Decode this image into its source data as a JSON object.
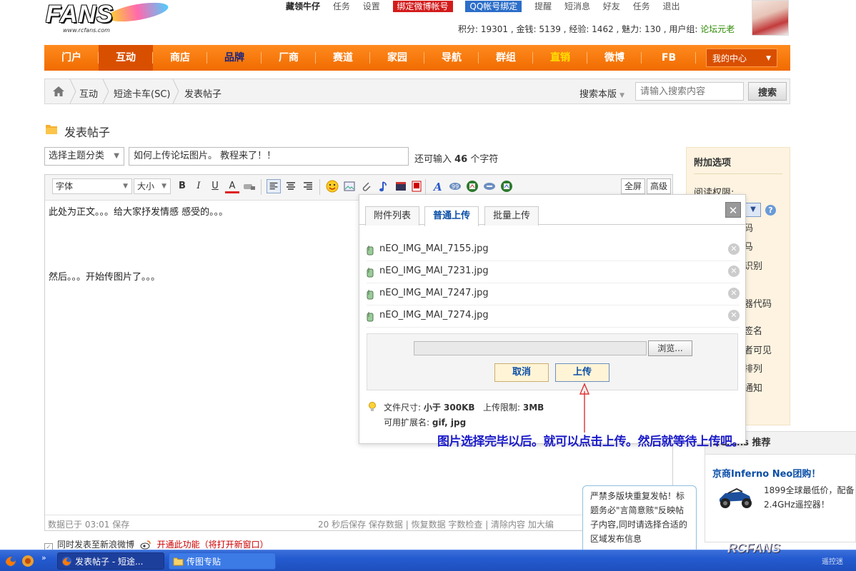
{
  "header": {
    "logo_text": "FANS",
    "logo_url": "www.rcfans.com",
    "top_links": [
      "藏领牛仔",
      "任务",
      "设置",
      "绑定微博帐号",
      "QQ帐号绑定",
      "提醒",
      "短消息",
      "好友",
      "任务",
      "退出"
    ],
    "stats_prefix": "积分: 19301 , 金钱: 5139 , 经验: 1462 , 魅力: 130 , 用户组: ",
    "user_group": "论坛元老"
  },
  "nav": {
    "items": [
      "门户",
      "互动",
      "商店",
      "品牌",
      "厂商",
      "赛道",
      "家园",
      "导航",
      "群组",
      "直销",
      "微博",
      "FB"
    ],
    "active": "互动",
    "my_center": "我的中心"
  },
  "breadcrumb": {
    "items": [
      "互动",
      "短途卡车(SC)",
      "发表帖子"
    ],
    "search_label": "搜索本版",
    "search_placeholder": "请输入搜索内容",
    "search_button": "搜索"
  },
  "post": {
    "page_title": "发表帖子",
    "topic_select": "选择主题分类",
    "subject": "如何上传论坛图片。  教程来了！！",
    "chars_left_prefix": "还可输入 ",
    "chars_left_num": "46",
    "chars_left_suffix": " 个字符"
  },
  "editor": {
    "font_select": "字体",
    "size_select": "大小",
    "bold": "B",
    "italic": "I",
    "underline": "U",
    "color": "A",
    "fullscreen": "全屏",
    "advanced": "高级",
    "body_line1": "此处为正文。。。给大家抒发情感 感受的。。。",
    "body_line2": "然后。。。开始传图片了。。。",
    "autosave": "数据已于 03:01 保存",
    "status_links": "20 秒后保存  保存数据 | 恢复数据    字数检查 | 清除内容    加大编"
  },
  "weibo": {
    "label": "同时发表至新浪微博",
    "warning": "开通此功能（将打开新窗口）"
  },
  "sidebar": {
    "title": "附加选项",
    "read_perm": "阅读权限:",
    "options": [
      "码",
      "马",
      "识别",
      "器代码",
      "签名",
      "者可见",
      "排列",
      "通知"
    ]
  },
  "recommend": {
    "head": "RCfans 推荐",
    "link": "京商Inferno Neo团购！",
    "desc_line1": "1899全球最低价，配备",
    "desc_line2": "2.4GHz遥控器！"
  },
  "notice": "严禁多版块重复发帖！标题务必\"言简意赅\"反映帖子内容,同时请选择合适的区域发布信息",
  "dialog": {
    "tabs": [
      "附件列表",
      "普通上传",
      "批量上传"
    ],
    "active_tab": "普通上传",
    "close": "✕",
    "files": [
      "nEO_IMG_MAI_7155.jpg",
      "nEO_IMG_MAI_7231.jpg",
      "nEO_IMG_MAI_7247.jpg",
      "nEO_IMG_MAI_7274.jpg"
    ],
    "browse": "浏览...",
    "cancel": "取消",
    "upload": "上传",
    "size_label": "文件尺寸: ",
    "size_value": "小于 300KB",
    "limit_label": "   上传限制: ",
    "limit_value": "3MB",
    "ext_label": "可用扩展名: ",
    "ext_value": "gif, jpg"
  },
  "annotation": "图片选择完毕以后。就可以点击上传。然后就等待上传吧。",
  "taskbar": {
    "task1": "发表帖子 - 短途...",
    "task2": "传图专贴"
  },
  "watermark": "RCFANS",
  "watermark_sub": "遥控迷"
}
